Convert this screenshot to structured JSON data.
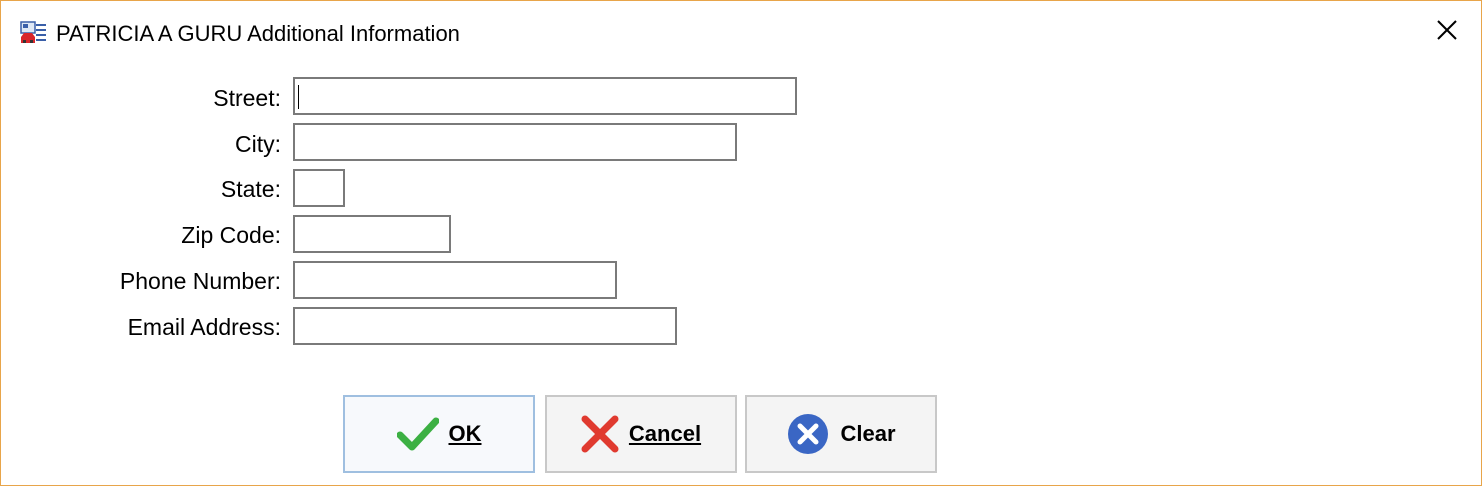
{
  "window": {
    "title": "PATRICIA A GURU Additional Information",
    "app_icon": "contact-card-icon",
    "close_icon": "close-icon"
  },
  "form": {
    "street": {
      "label": "Street:",
      "value": ""
    },
    "city": {
      "label": "City:",
      "value": ""
    },
    "state": {
      "label": "State:",
      "value": ""
    },
    "zip": {
      "label": "Zip Code:",
      "value": ""
    },
    "phone": {
      "label": "Phone Number:",
      "value": ""
    },
    "email": {
      "label": "Email Address:",
      "value": ""
    }
  },
  "buttons": {
    "ok": {
      "label": "OK",
      "icon": "checkmark-icon"
    },
    "cancel": {
      "label": "Cancel",
      "icon": "x-mark-icon"
    },
    "clear": {
      "label": "Clear",
      "icon": "clear-circle-icon"
    }
  },
  "colors": {
    "window_border": "#e8a54a",
    "ok_green": "#3cb043",
    "cancel_red": "#e03a2f",
    "clear_blue": "#3a66c4"
  }
}
